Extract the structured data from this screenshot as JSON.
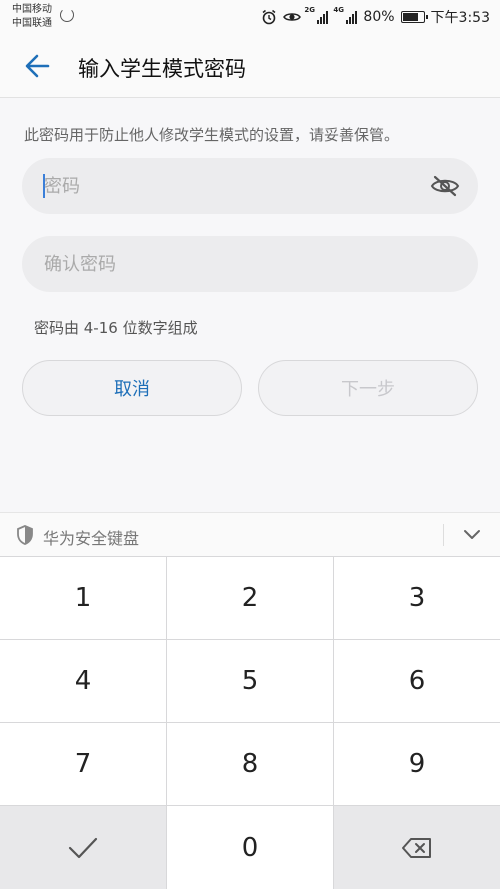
{
  "status_bar": {
    "carrier1": "中国移动",
    "carrier2": "中国联通",
    "net1": "2G",
    "net2": "4G",
    "battery": "80%",
    "battery_level": 0.8,
    "time": "下午3:53"
  },
  "header": {
    "title": "输入学生模式密码",
    "back_icon": "back-arrow-icon"
  },
  "description": "此密码用于防止他人修改学生模式的设置，请妥善保管。",
  "password": {
    "placeholder": "密码",
    "value": "",
    "toggle_icon": "eye-hidden-icon"
  },
  "confirm": {
    "placeholder": "确认密码",
    "value": ""
  },
  "hint": "密码由 4-16 位数字组成",
  "buttons": {
    "cancel": "取消",
    "next": "下一步"
  },
  "keyboard": {
    "title": "华为安全键盘",
    "keys": [
      "1",
      "2",
      "3",
      "4",
      "5",
      "6",
      "7",
      "8",
      "9",
      "✓",
      "0",
      "⌫"
    ]
  },
  "colors": {
    "accent": "#1e6fb8",
    "disabled": "#c8c8cc",
    "caret": "#3b7fd9"
  }
}
